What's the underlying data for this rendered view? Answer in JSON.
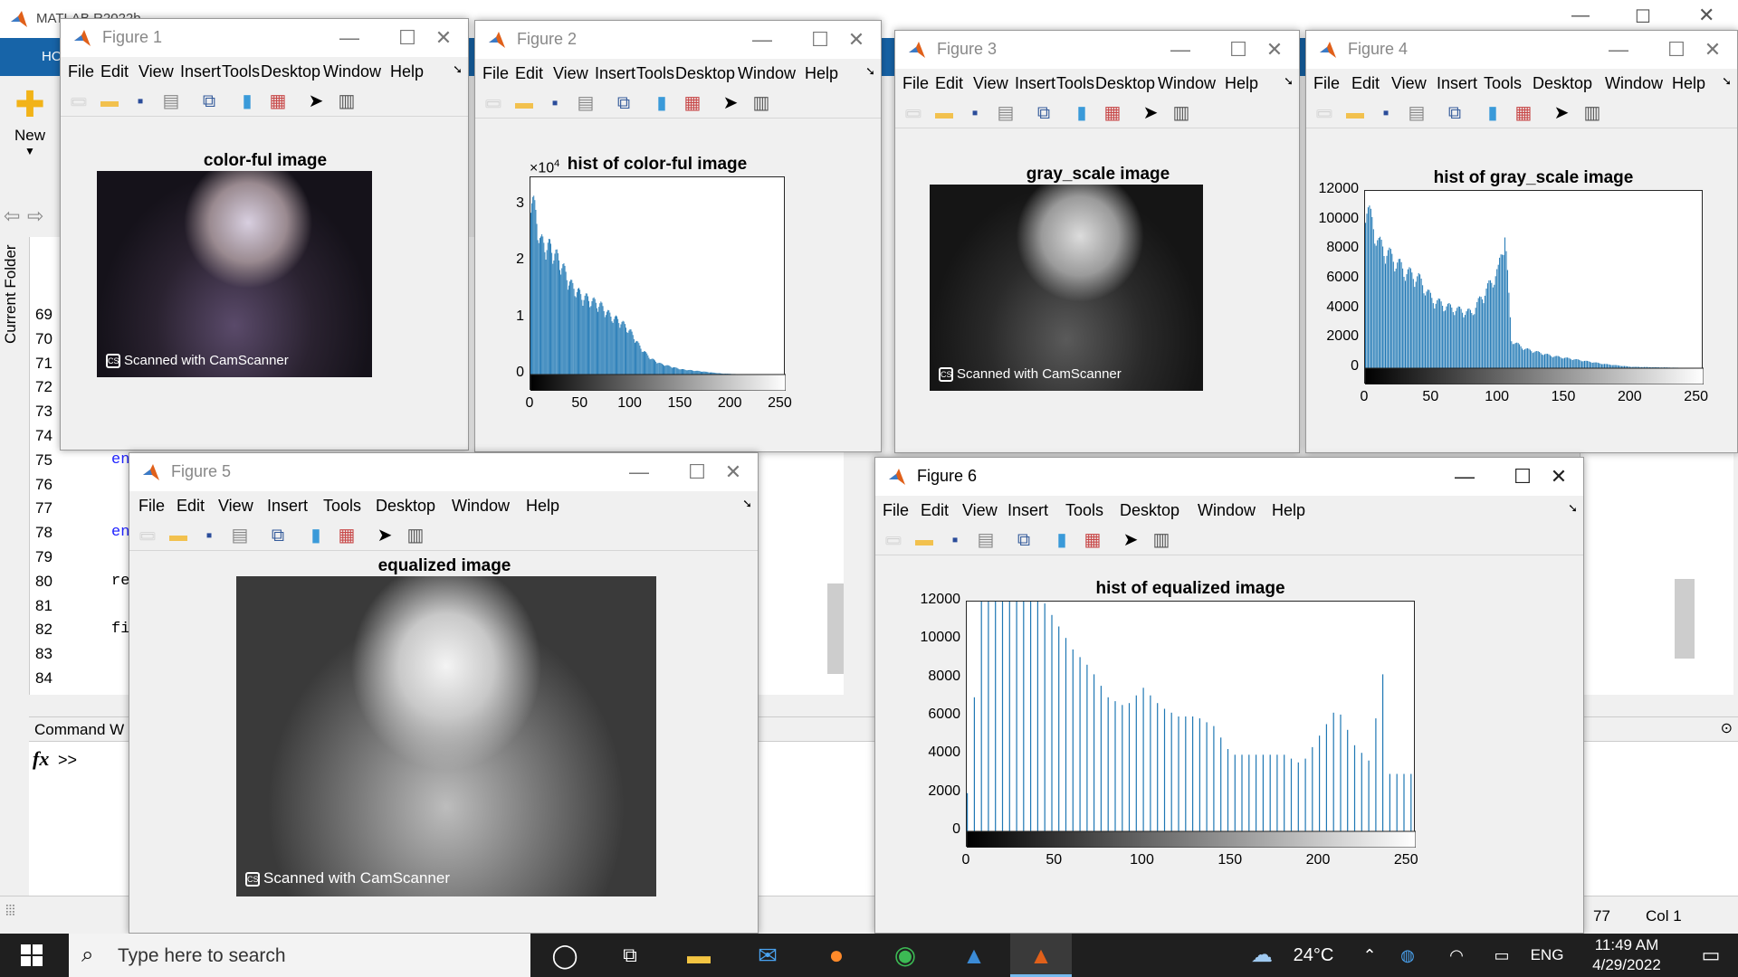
{
  "matlab": {
    "title": "MATLAB R2022b",
    "home_tab": "HOME",
    "new_label": "New",
    "current_folder_label": "Current Folder",
    "line_numbers": [
      "69",
      "70",
      "71",
      "72",
      "73",
      "74",
      "75",
      "76",
      "77",
      "78",
      "79",
      "80",
      "81",
      "82",
      "83",
      "84"
    ],
    "code_fragments": [
      {
        "line": "75",
        "text": "end"
      },
      {
        "line": "78",
        "text": "end"
      },
      {
        "line": "80",
        "text": "re"
      },
      {
        "line": "82",
        "text": "fi"
      }
    ],
    "command_window_label": "Command W",
    "prompt": ">>",
    "status_ln": "77",
    "status_col": "Col 1"
  },
  "menus": [
    "File",
    "Edit",
    "View",
    "Insert",
    "Tools",
    "Desktop",
    "Window",
    "Help"
  ],
  "figures": [
    {
      "title": "Figure 1",
      "axes_title": "color-ful image",
      "watermark": "Scanned with CamScanner"
    },
    {
      "title": "Figure 2",
      "axes_title": "hist of color-ful image",
      "exponent": "×10",
      "exponent_power": "4",
      "yticks": [
        "0",
        "1",
        "2",
        "3"
      ],
      "xticks": [
        "0",
        "50",
        "100",
        "150",
        "200",
        "250"
      ]
    },
    {
      "title": "Figure 3",
      "axes_title": "gray_scale image",
      "watermark": "Scanned with CamScanner"
    },
    {
      "title": "Figure 4",
      "axes_title": "hist of gray_scale image",
      "yticks": [
        "0",
        "2000",
        "4000",
        "6000",
        "8000",
        "10000",
        "12000"
      ],
      "xticks": [
        "0",
        "50",
        "100",
        "150",
        "200",
        "250"
      ]
    },
    {
      "title": "Figure 5",
      "axes_title": "equalized image",
      "watermark": "Scanned with CamScanner"
    },
    {
      "title": "Figure 6",
      "axes_title": "hist of equalized image",
      "yticks": [
        "0",
        "2000",
        "4000",
        "6000",
        "8000",
        "10000",
        "12000"
      ],
      "xticks": [
        "0",
        "50",
        "100",
        "150",
        "200",
        "250"
      ]
    }
  ],
  "chart_data": [
    {
      "type": "bar",
      "title": "hist of color-ful image",
      "xlim": [
        0,
        255
      ],
      "ylim": [
        0,
        35000
      ],
      "ylabel_multiplier": "×10^4",
      "series": [
        {
          "values_shape": "decaying",
          "peak": 35000,
          "bins": [
            [
              0,
              35000
            ],
            [
              10,
              25000
            ],
            [
              20,
              24000
            ],
            [
              30,
              21000
            ],
            [
              40,
              17000
            ],
            [
              50,
              15000
            ],
            [
              60,
              14000
            ],
            [
              70,
              13000
            ],
            [
              80,
              11000
            ],
            [
              90,
              10000
            ],
            [
              100,
              8000
            ],
            [
              110,
              5000
            ],
            [
              120,
              3000
            ],
            [
              130,
              2000
            ],
            [
              140,
              1500
            ],
            [
              150,
              1000
            ],
            [
              170,
              600
            ],
            [
              190,
              200
            ],
            [
              210,
              50
            ],
            [
              255,
              0
            ]
          ]
        }
      ]
    },
    {
      "type": "bar",
      "title": "hist of gray_scale image",
      "xlim": [
        0,
        255
      ],
      "ylim": [
        0,
        12000
      ],
      "series": [
        {
          "bins": [
            [
              0,
              12000
            ],
            [
              10,
              9000
            ],
            [
              20,
              8000
            ],
            [
              30,
              7000
            ],
            [
              40,
              6500
            ],
            [
              50,
              5000
            ],
            [
              60,
              4500
            ],
            [
              70,
              4200
            ],
            [
              80,
              4000
            ],
            [
              90,
              5500
            ],
            [
              100,
              7000
            ],
            [
              105,
              9800
            ],
            [
              110,
              2000
            ],
            [
              120,
              1400
            ],
            [
              140,
              900
            ],
            [
              160,
              600
            ],
            [
              180,
              300
            ],
            [
              200,
              100
            ],
            [
              255,
              0
            ]
          ]
        }
      ]
    },
    {
      "type": "bar",
      "title": "hist of equalized image",
      "xlim": [
        0,
        255
      ],
      "ylim": [
        0,
        12000
      ],
      "series": [
        {
          "bins": [
            [
              0,
              2000
            ],
            [
              8,
              12000
            ],
            [
              20,
              12500
            ],
            [
              30,
              12500
            ],
            [
              40,
              12500
            ],
            [
              50,
              11000
            ],
            [
              60,
              9500
            ],
            [
              70,
              8500
            ],
            [
              80,
              7000
            ],
            [
              90,
              6500
            ],
            [
              100,
              7500
            ],
            [
              110,
              6500
            ],
            [
              120,
              6000
            ],
            [
              130,
              6000
            ],
            [
              140,
              5500
            ],
            [
              150,
              4000
            ],
            [
              160,
              4000
            ],
            [
              170,
              4000
            ],
            [
              180,
              4000
            ],
            [
              190,
              3500
            ],
            [
              200,
              5000
            ],
            [
              210,
              6500
            ],
            [
              220,
              4500
            ],
            [
              230,
              3500
            ],
            [
              235,
              9500
            ],
            [
              240,
              3000
            ],
            [
              250,
              3000
            ],
            [
              255,
              3000
            ]
          ]
        }
      ]
    }
  ],
  "taskbar": {
    "search_placeholder": "Type here to search",
    "temperature": "24°C",
    "language": "ENG",
    "time": "11:49 AM",
    "date": "4/29/2022"
  }
}
